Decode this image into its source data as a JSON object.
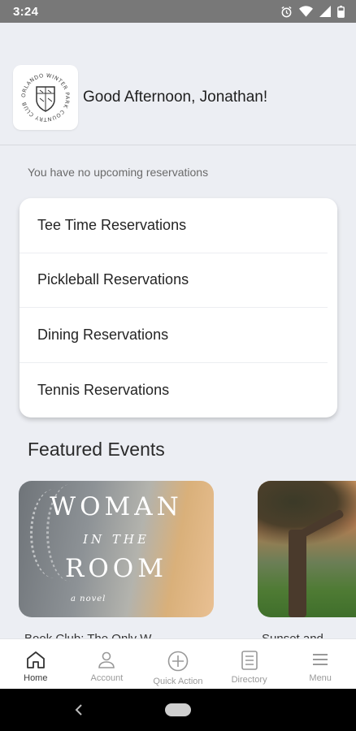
{
  "status_bar": {
    "time": "3:24"
  },
  "header": {
    "logo_text": "ORLANDO WINTER PARK COUNTRY CLUB",
    "greeting": "Good Afternoon, Jonathan!"
  },
  "reservations": {
    "empty_message": "You have no upcoming reservations",
    "items": [
      {
        "label": "Tee Time Reservations"
      },
      {
        "label": "Pickleball Reservations"
      },
      {
        "label": "Dining Reservations"
      },
      {
        "label": "Tennis Reservations"
      }
    ]
  },
  "featured": {
    "title": "Featured Events",
    "events": [
      {
        "cover_lines": [
          "WOMAN",
          "IN THE",
          "ROOM",
          "a novel"
        ],
        "caption": "Book Club: The Only W..."
      },
      {
        "caption": "Sunset and..."
      }
    ]
  },
  "tabbar": {
    "active": "Home",
    "tabs": [
      {
        "label": "Home",
        "icon": "home-icon"
      },
      {
        "label": "Account",
        "icon": "account-icon"
      },
      {
        "label": "Quick Action",
        "icon": "plus-circle-icon"
      },
      {
        "label": "Directory",
        "icon": "directory-icon"
      },
      {
        "label": "Menu",
        "icon": "menu-icon"
      }
    ]
  },
  "colors": {
    "background": "#eceef3",
    "status_bar": "#787878",
    "card": "#ffffff",
    "nav_bar": "#000000"
  }
}
